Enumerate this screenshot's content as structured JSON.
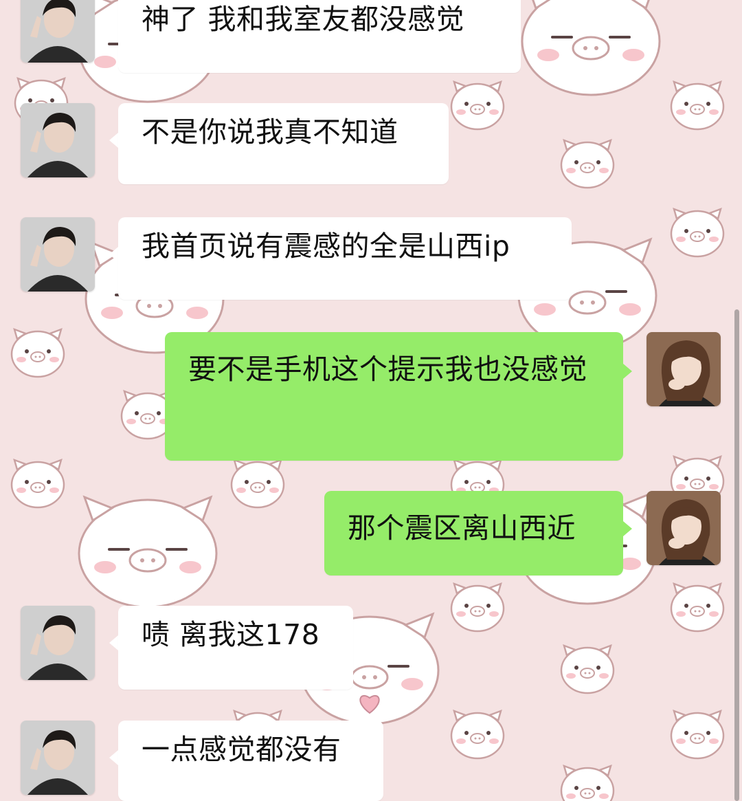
{
  "chat": {
    "messages": [
      {
        "sender": "friend",
        "avatar": "male-avatar",
        "text": "神了 我和我室友都没感觉"
      },
      {
        "sender": "friend",
        "avatar": "male-avatar",
        "text": "不是你说我真不知道"
      },
      {
        "sender": "friend",
        "avatar": "male-avatar",
        "text": "我首页说有震感的全是山西ip"
      },
      {
        "sender": "me",
        "avatar": "female-avatar",
        "text": "要不是手机这个提示我也没感觉"
      },
      {
        "sender": "me",
        "avatar": "female-avatar",
        "text": "那个震区离山西近"
      },
      {
        "sender": "friend",
        "avatar": "male-avatar",
        "text": "啧 离我这178"
      },
      {
        "sender": "friend",
        "avatar": "male-avatar",
        "text": "一点感觉都没有"
      }
    ]
  },
  "theme": {
    "wallpaper": "pink-pig-pattern",
    "wallpaper_color": "#f5e3e3",
    "incoming_bubble_color": "#ffffff",
    "outgoing_bubble_color": "#95ec69"
  }
}
